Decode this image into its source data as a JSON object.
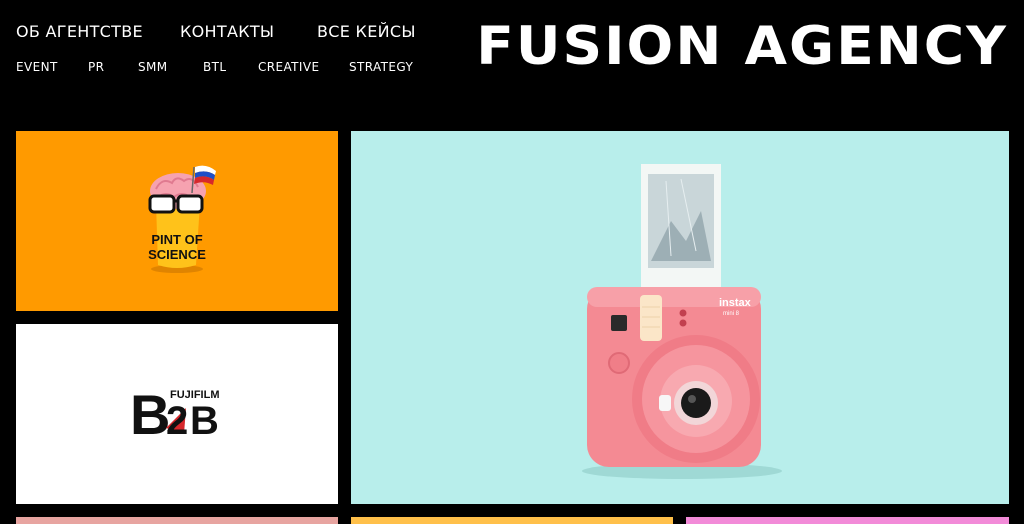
{
  "nav": {
    "primary": [
      {
        "label": "ОБ АГЕНТСТВЕ"
      },
      {
        "label": "КОНТАКТЫ"
      },
      {
        "label": "ВСЕ КЕЙСЫ"
      }
    ],
    "categories": [
      {
        "label": "EVENT"
      },
      {
        "label": "PR"
      },
      {
        "label": "SMM"
      },
      {
        "label": "BTL"
      },
      {
        "label": "CREATIVE"
      },
      {
        "label": "STRATEGY"
      }
    ]
  },
  "logo": {
    "text": "FUSION AGENCY"
  },
  "tiles": {
    "pint_of_science": {
      "line1": "PINT OF",
      "line2": "SCIENCE",
      "bg": "#FF9A00"
    },
    "fujifilm_b2b": {
      "brand": "FUJIFILM",
      "letter_b": "B",
      "digit": "2",
      "letter_b2": "B",
      "bg": "#FFFFFF"
    },
    "instax": {
      "brand": "instax",
      "model": "mini 8",
      "bg": "#B8EEEB",
      "camera_color": "#F48A93"
    }
  },
  "bottom_tiles": {
    "colors": [
      "#E7A4A0",
      "#FFC04A",
      "#F28BD8"
    ]
  },
  "colors": {
    "background": "#000000",
    "text": "#FFFFFF"
  }
}
